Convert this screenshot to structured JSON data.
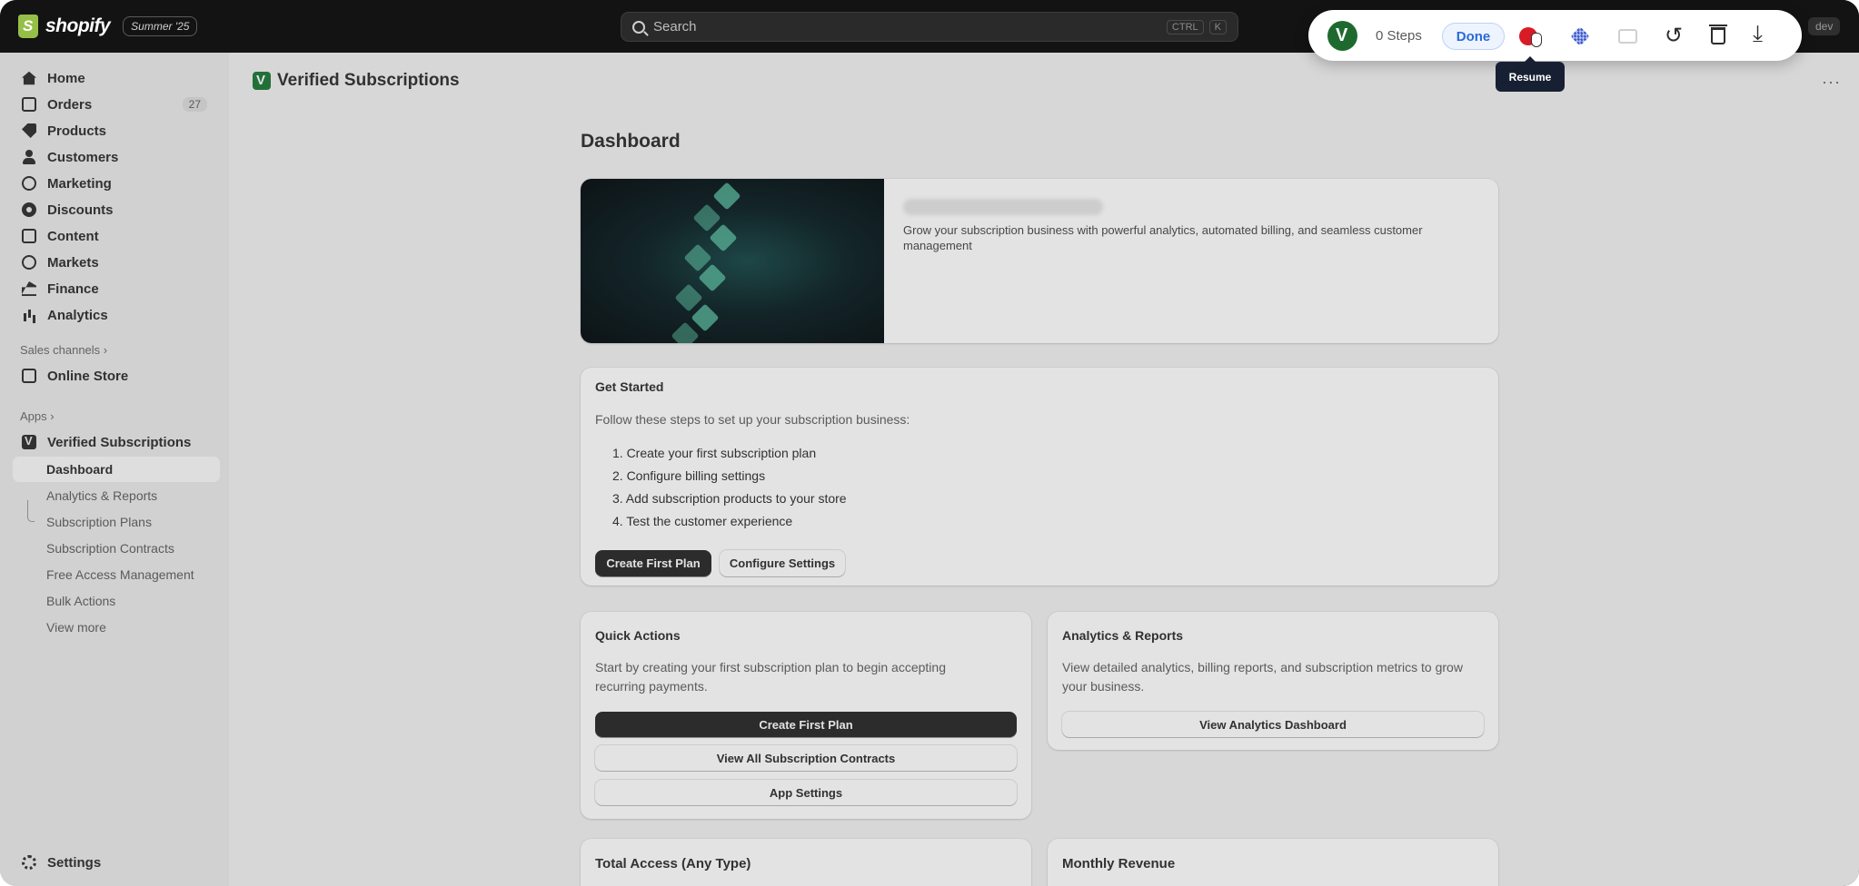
{
  "topbar": {
    "brand": "shopify",
    "edition_badge": "Summer '25",
    "search_placeholder": "Search",
    "shortcut_ctrl": "CTRL",
    "shortcut_key": "K",
    "env_badge": "dev"
  },
  "sidebar": {
    "items": [
      {
        "label": "Home",
        "icon": "home-icon"
      },
      {
        "label": "Orders",
        "icon": "orders-icon",
        "count": "27"
      },
      {
        "label": "Products",
        "icon": "tag-icon"
      },
      {
        "label": "Customers",
        "icon": "person-icon"
      },
      {
        "label": "Marketing",
        "icon": "target-icon"
      },
      {
        "label": "Discounts",
        "icon": "discount-icon"
      },
      {
        "label": "Content",
        "icon": "content-icon"
      },
      {
        "label": "Markets",
        "icon": "globe-icon"
      },
      {
        "label": "Finance",
        "icon": "bank-icon"
      },
      {
        "label": "Analytics",
        "icon": "bar-chart-icon"
      }
    ],
    "sales_channels_label": "Sales channels",
    "online_store": "Online Store",
    "apps_label": "Apps",
    "app_name": "Verified Subscriptions",
    "app_subitems": [
      "Dashboard",
      "Analytics & Reports",
      "Subscription Plans",
      "Subscription Contracts",
      "Free Access Management",
      "Bulk Actions",
      "View more"
    ],
    "settings": "Settings",
    "chevron": "›"
  },
  "header": {
    "app_title": "Verified Subscriptions",
    "more": "···"
  },
  "page": {
    "title": "Dashboard",
    "hero_description": "Grow your subscription business with powerful analytics, automated billing, and seamless customer management",
    "get_started": {
      "title": "Get Started",
      "intro": "Follow these steps to set up your subscription business:",
      "steps": [
        "1. Create your first subscription plan",
        "2. Configure billing settings",
        "3. Add subscription products to your store",
        "4. Test the customer experience"
      ],
      "primary_button": "Create First Plan",
      "secondary_button": "Configure Settings"
    },
    "quick_actions": {
      "title": "Quick Actions",
      "text": "Start by creating your first subscription plan to begin accepting recurring payments.",
      "primary_button": "Create First Plan",
      "contracts_button": "View All Subscription Contracts",
      "settings_button": "App Settings"
    },
    "analytics_card": {
      "title": "Analytics & Reports",
      "text": "View detailed analytics, billing reports, and subscription metrics to grow your business.",
      "button": "View Analytics Dashboard"
    },
    "total_access_title": "Total Access (Any Type)",
    "monthly_revenue_title": "Monthly Revenue"
  },
  "recorder": {
    "steps_label": "0 Steps",
    "done_button": "Done",
    "undo_glyph": "↺",
    "arrow_glyph": "⤓",
    "tooltip": "Resume"
  }
}
